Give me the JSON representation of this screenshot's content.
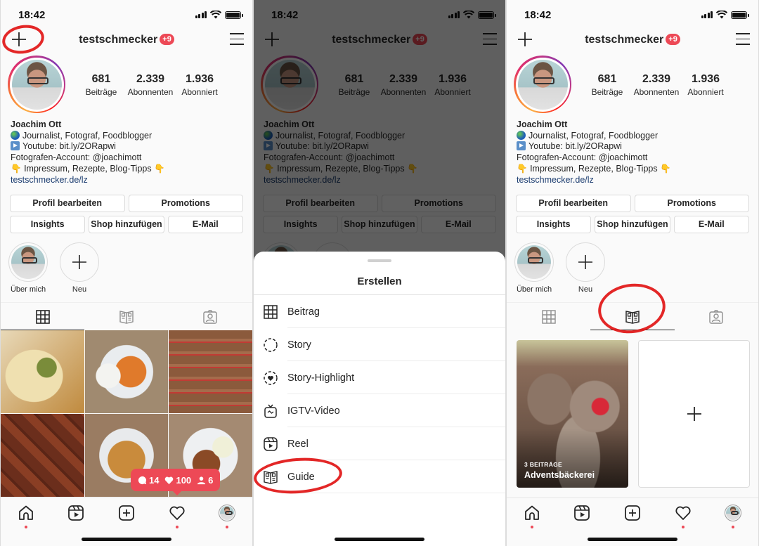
{
  "status": {
    "time": "18:42"
  },
  "profile": {
    "username": "testschmecker",
    "notification_badge": "+9",
    "stats": [
      {
        "value": "681",
        "label": "Beiträge"
      },
      {
        "value": "2.339",
        "label": "Abonnenten"
      },
      {
        "value": "1.936",
        "label": "Abonniert"
      }
    ],
    "name": "Joachim Ott",
    "bio_lines": [
      "Journalist, Fotograf, Foodblogger",
      "Youtube: bit.ly/2ORapwi",
      "Fotografen-Account: @joachimott",
      "Impressum, Rezepte, Blog-Tipps"
    ],
    "bio_emoji_hand": "👇",
    "website": "testschmecker.de/lz"
  },
  "buttons": {
    "edit_profile": "Profil bearbeiten",
    "promotions": "Promotions",
    "insights": "Insights",
    "add_shop": "Shop hinzufügen",
    "email": "E-Mail"
  },
  "highlights": [
    {
      "label": "Über mich"
    },
    {
      "label": "Neu"
    }
  ],
  "activity_popup": {
    "comments": "14",
    "likes": "100",
    "followers": "6"
  },
  "create_sheet": {
    "title": "Erstellen",
    "items": [
      {
        "label": "Beitrag",
        "icon": "grid-icon"
      },
      {
        "label": "Story",
        "icon": "story-icon"
      },
      {
        "label": "Story-Highlight",
        "icon": "story-highlight-icon"
      },
      {
        "label": "IGTV-Video",
        "icon": "igtv-icon"
      },
      {
        "label": "Reel",
        "icon": "reel-icon"
      },
      {
        "label": "Guide",
        "icon": "guide-icon"
      }
    ]
  },
  "guides": [
    {
      "count": "3 BEITRÄGE",
      "title": "Adventsbäckerei"
    }
  ],
  "colors": {
    "accent_red": "#ed4956",
    "link": "#1c3d70",
    "annotation": "#e01010"
  }
}
